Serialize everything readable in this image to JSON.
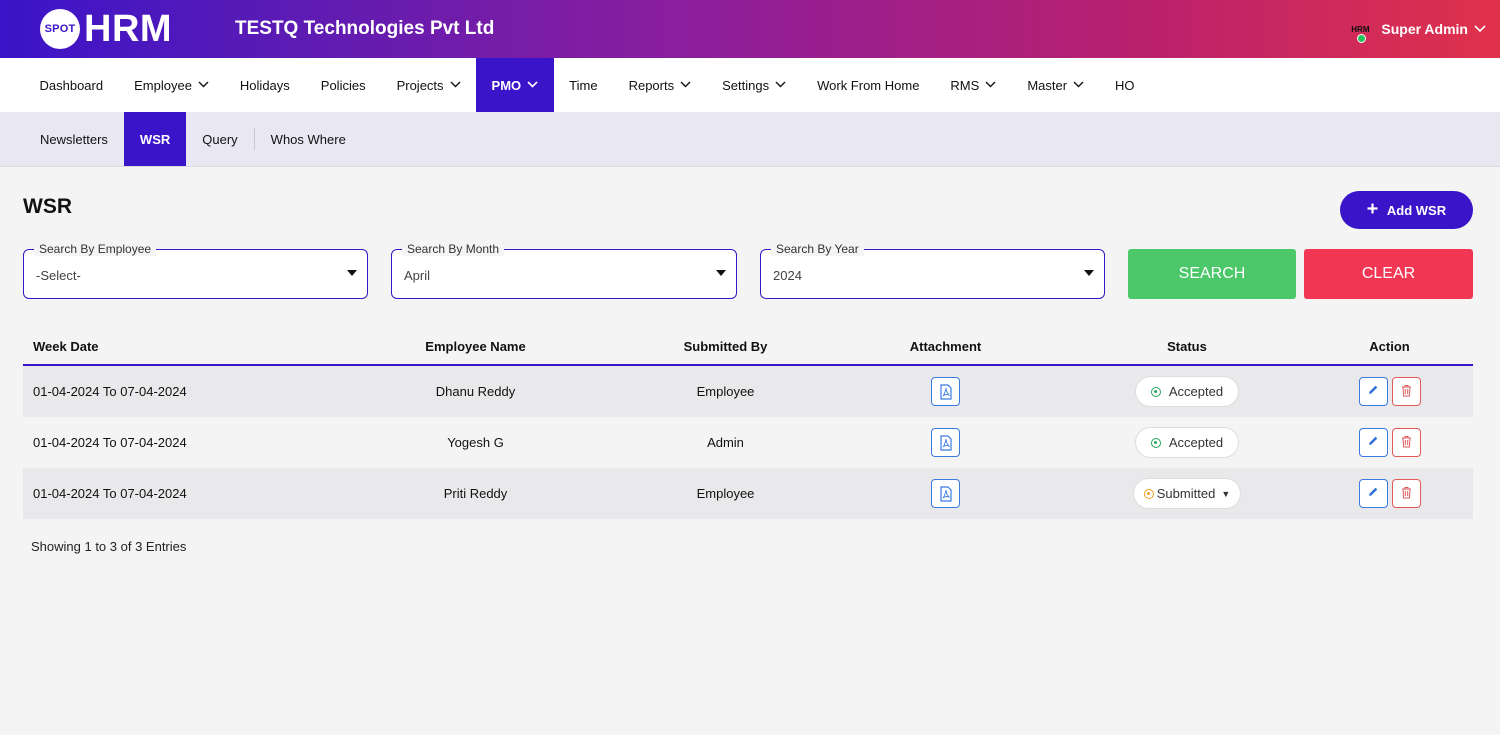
{
  "header": {
    "logo_badge": "SPOT",
    "logo_text": "HRM",
    "company": "TESTQ Technologies Pvt Ltd",
    "user_avatar": "HRM",
    "user_name": "Super Admin"
  },
  "mainnav": {
    "items": [
      {
        "label": "Dashboard"
      },
      {
        "label": "Employee"
      },
      {
        "label": "Holidays"
      },
      {
        "label": "Policies"
      },
      {
        "label": "Projects"
      },
      {
        "label": "PMO"
      },
      {
        "label": "Time"
      },
      {
        "label": "Reports"
      },
      {
        "label": "Settings"
      },
      {
        "label": "Work From Home"
      },
      {
        "label": "RMS"
      },
      {
        "label": "Master"
      },
      {
        "label": "HO"
      }
    ],
    "active": "PMO"
  },
  "subnav": {
    "items": [
      {
        "label": "Newsletters"
      },
      {
        "label": "WSR"
      },
      {
        "label": "Query"
      },
      {
        "label": "Whos Where"
      }
    ],
    "active": "WSR"
  },
  "page": {
    "title": "WSR",
    "add_button": "Add WSR"
  },
  "filters": {
    "employee": {
      "label": "Search By Employee",
      "value": "-Select-"
    },
    "month": {
      "label": "Search By Month",
      "value": "April"
    },
    "year": {
      "label": "Search By Year",
      "value": "2024"
    },
    "search_button": "SEARCH",
    "clear_button": "CLEAR"
  },
  "table": {
    "columns": [
      "Week Date",
      "Employee Name",
      "Submitted By",
      "Attachment",
      "Status",
      "Action"
    ],
    "rows": [
      {
        "week": "01-04-2024 To 07-04-2024",
        "employee": "Dhanu Reddy",
        "submitted_by": "Employee",
        "status": "Accepted"
      },
      {
        "week": "01-04-2024 To 07-04-2024",
        "employee": "Yogesh G",
        "submitted_by": "Admin",
        "status": "Accepted"
      },
      {
        "week": "01-04-2024 To 07-04-2024",
        "employee": "Priti Reddy",
        "submitted_by": "Employee",
        "status": "Submitted"
      }
    ]
  },
  "footer": {
    "entries_text": "Showing 1 to 3 of 3 Entries"
  },
  "colors": {
    "brand": "#3a14c9",
    "search": "#4cc86a",
    "clear": "#f23755",
    "accepted": "#26a65b",
    "submitted": "#f0a020"
  }
}
